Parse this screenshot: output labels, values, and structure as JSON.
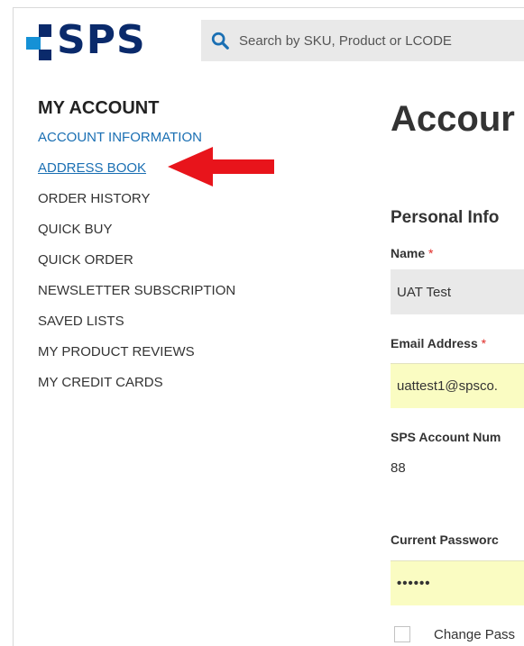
{
  "header": {
    "logo_text": "SPS",
    "search_placeholder": "Search by SKU, Product or LCODE"
  },
  "sidebar": {
    "title": "MY ACCOUNT",
    "items": [
      {
        "label": "ACCOUNT INFORMATION",
        "state": "active"
      },
      {
        "label": "ADDRESS BOOK",
        "state": "link-highlighted"
      },
      {
        "label": "ORDER HISTORY"
      },
      {
        "label": "QUICK BUY"
      },
      {
        "label": "QUICK ORDER"
      },
      {
        "label": "NEWSLETTER SUBSCRIPTION"
      },
      {
        "label": "SAVED LISTS"
      },
      {
        "label": "MY PRODUCT REVIEWS"
      },
      {
        "label": "MY CREDIT CARDS"
      }
    ]
  },
  "annotation": {
    "arrow_color": "#e8141b",
    "points_to": "ADDRESS BOOK"
  },
  "main": {
    "page_title": "Accour",
    "section_title": "Personal Info",
    "name": {
      "label": "Name",
      "required_mark": "*",
      "value": "UAT Test"
    },
    "email": {
      "label": "Email Address",
      "required_mark": "*",
      "value": "uattest1@spsco."
    },
    "account_number": {
      "label": "SPS Account Num",
      "value": "88"
    },
    "current_password": {
      "label": "Current Passworc",
      "value": "••••••"
    },
    "change_password": {
      "label": "Change Pass",
      "checked": false
    }
  },
  "colors": {
    "brand_dark": "#0a2a6b",
    "brand_light": "#1591d6",
    "link": "#1a6fb3",
    "required": "#e02b27",
    "autofill": "#fafcc2"
  }
}
